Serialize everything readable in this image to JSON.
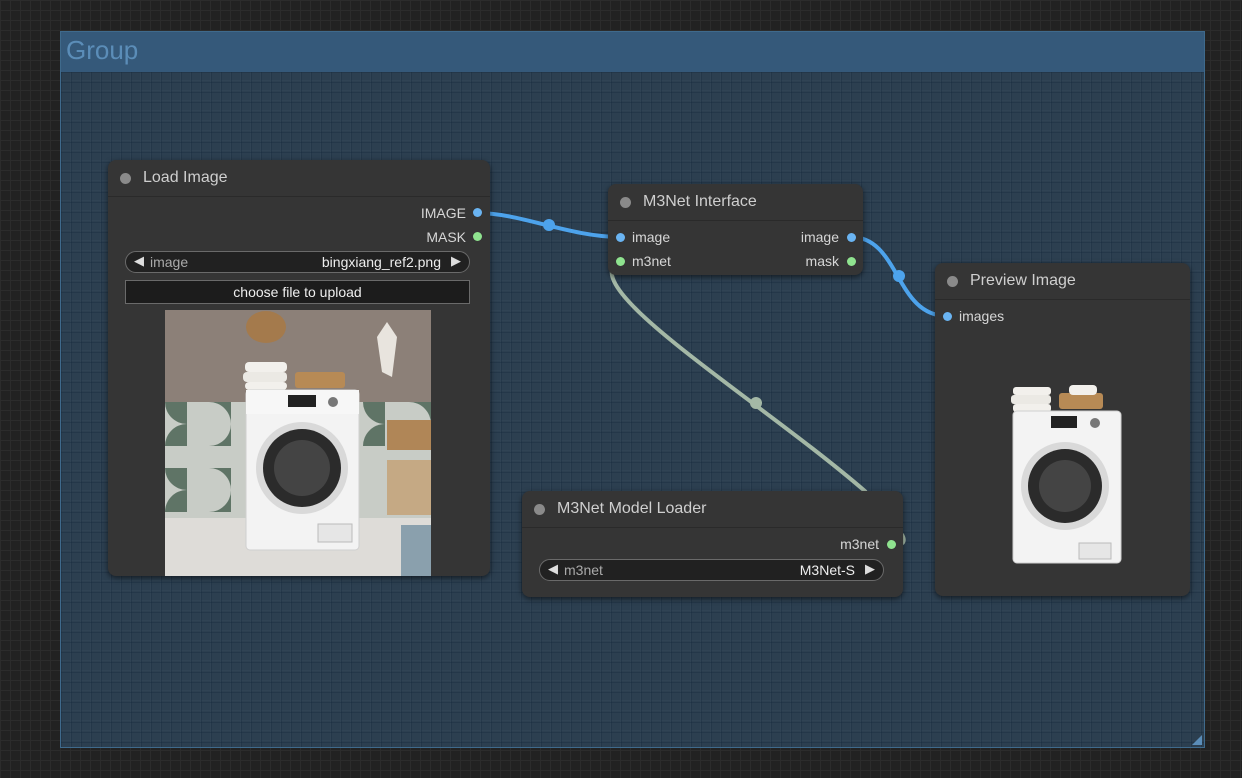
{
  "group": {
    "title": "Group"
  },
  "nodes": {
    "load_image": {
      "title": "Load Image",
      "outputs": [
        "IMAGE",
        "MASK"
      ],
      "widget_image": {
        "name": "image",
        "value": "bingxiang_ref2.png"
      },
      "upload_label": "choose file to upload"
    },
    "m3net_interface": {
      "title": "M3Net Interface",
      "inputs": [
        "image",
        "m3net"
      ],
      "outputs": [
        "image",
        "mask"
      ]
    },
    "preview_image": {
      "title": "Preview Image",
      "inputs": [
        "images"
      ]
    },
    "model_loader": {
      "title": "M3Net Model Loader",
      "outputs": [
        "m3net"
      ],
      "widget_m3net": {
        "name": "m3net",
        "value": "M3Net-S"
      }
    }
  },
  "colors": {
    "image_wire": "#4da3ec",
    "m3net_wire": "#a4b8a6",
    "group": "#345876"
  },
  "icons": {
    "combo_left": "◀",
    "combo_right": "▶"
  }
}
